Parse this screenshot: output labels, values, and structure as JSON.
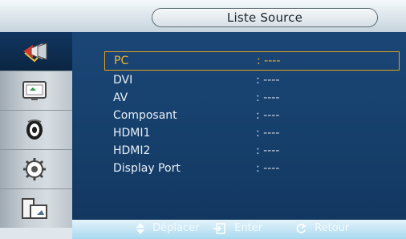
{
  "header": {
    "title": "Liste Source"
  },
  "sidebar": {
    "items": [
      {
        "icon": "input-source-icon",
        "selected": true
      },
      {
        "icon": "picture-icon",
        "selected": false
      },
      {
        "icon": "sound-icon",
        "selected": false
      },
      {
        "icon": "setup-icon",
        "selected": false
      },
      {
        "icon": "multi-screen-icon",
        "selected": false
      }
    ]
  },
  "sources": {
    "items": [
      {
        "name": "PC",
        "value": ": ----"
      },
      {
        "name": "DVI",
        "value": ": ----"
      },
      {
        "name": "AV",
        "value": ": ----"
      },
      {
        "name": "Composant",
        "value": ": ----"
      },
      {
        "name": "HDMI1",
        "value": ": ----"
      },
      {
        "name": "HDMI2",
        "value": ": ----"
      },
      {
        "name": "Display Port",
        "value": ": ----"
      }
    ]
  },
  "hints": {
    "move": "Déplacer",
    "enter": "Enter",
    "return": "Retour"
  },
  "colors": {
    "panel": "#163f6b",
    "selected_text": "#f1b12a",
    "selected_border": "#e3a11d",
    "text": "#e8f0f7"
  }
}
